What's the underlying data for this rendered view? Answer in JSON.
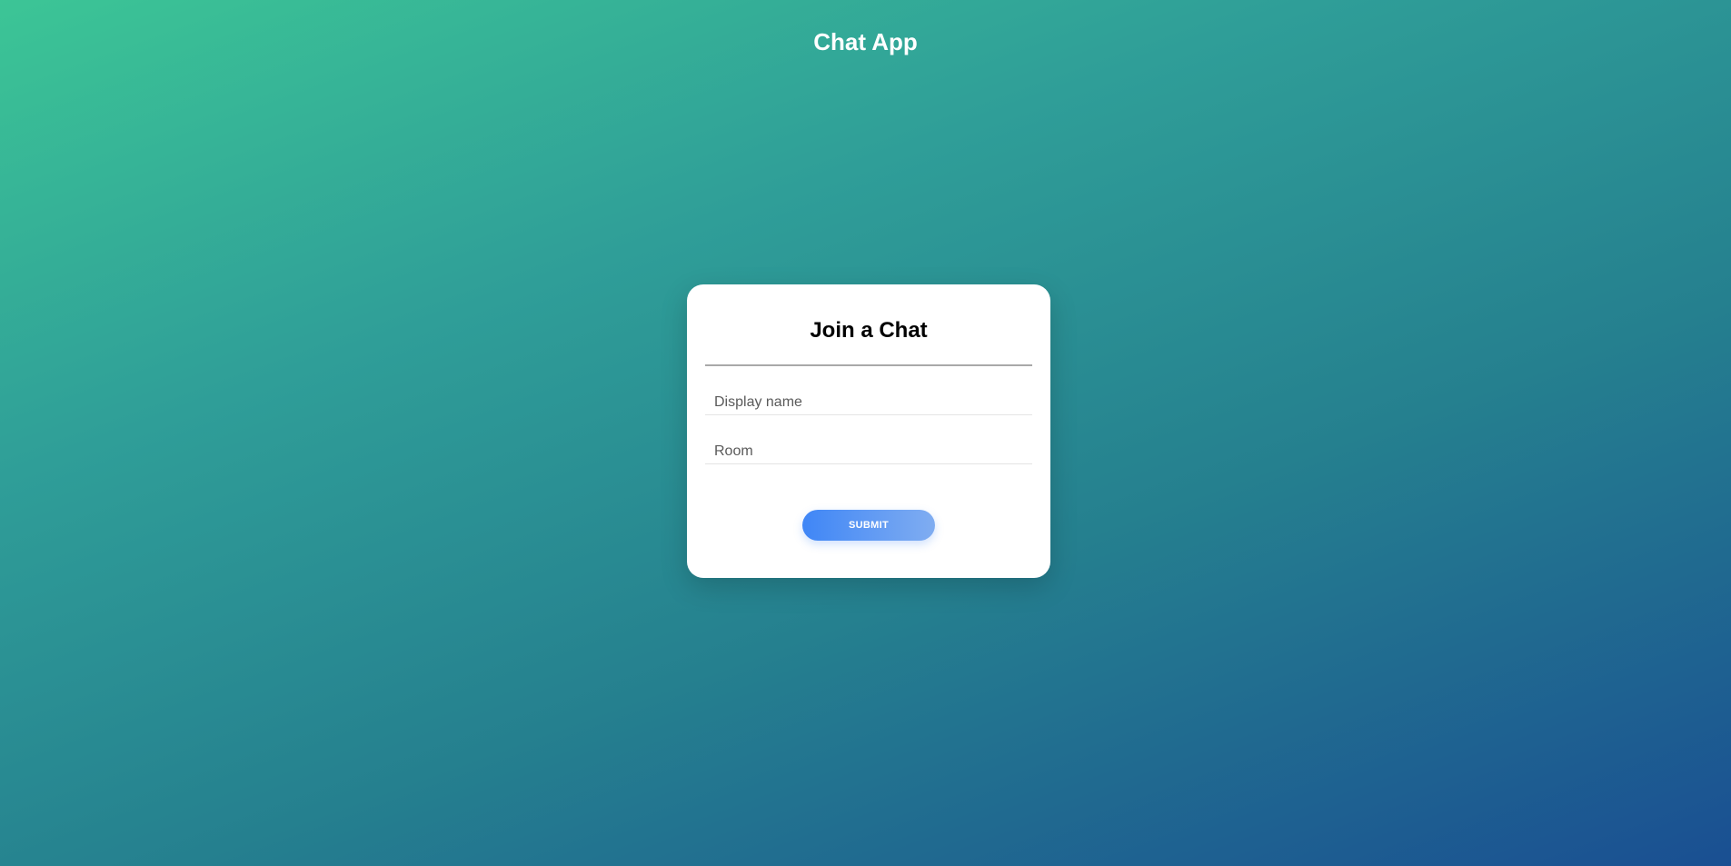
{
  "header": {
    "title": "Chat App"
  },
  "join_card": {
    "title": "Join a Chat",
    "display_name_field": {
      "value": "",
      "placeholder": "Display name"
    },
    "room_field": {
      "value": "",
      "placeholder": "Room"
    },
    "submit_label": "SUBMIT"
  },
  "colors": {
    "background_gradient_start": "#3cc596",
    "background_gradient_end": "#1a4f92",
    "card_background": "#ffffff",
    "button_gradient_start": "#3f86f6",
    "button_gradient_end": "#80adf1"
  }
}
